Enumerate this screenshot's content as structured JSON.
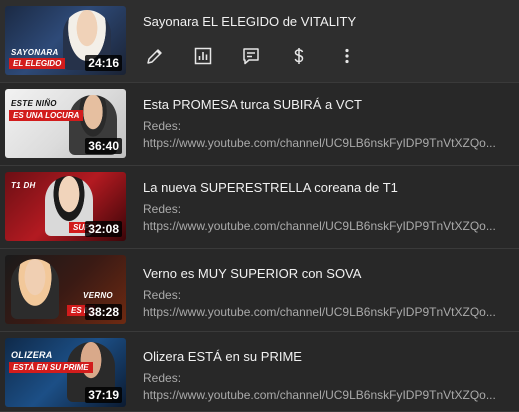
{
  "videos": [
    {
      "title": "Sayonara EL ELEGIDO de VITALITY",
      "duration": "24:16",
      "thumb_line": "SAYONARA",
      "thumb_red": "EL ELEGIDO",
      "actions": [
        "edit-icon",
        "analytics-icon",
        "comments-icon",
        "monetization-icon",
        "more-options-icon"
      ]
    },
    {
      "title": "Esta PROMESA turca SUBIRÁ a VCT",
      "duration": "36:40",
      "thumb_line": "ESTE NIÑO",
      "thumb_red": "ES UNA LOCURA",
      "desc_label": "Redes:",
      "desc_url": "https://www.youtube.com/channel/UC9LB6nskFyIDP9TnVtXZQo..."
    },
    {
      "title": "La nueva SUPERESTRELLA coreana de T1",
      "duration": "32:08",
      "thumb_line": "T1 DH",
      "thumb_red": "SUPI",
      "desc_label": "Redes:",
      "desc_url": "https://www.youtube.com/channel/UC9LB6nskFyIDP9TnVtXZQo..."
    },
    {
      "title": "Verno es MUY SUPERIOR con SOVA",
      "duration": "38:28",
      "thumb_line": "VERNO",
      "thumb_red": "ES M",
      "desc_label": "Redes:",
      "desc_url": "https://www.youtube.com/channel/UC9LB6nskFyIDP9TnVtXZQo..."
    },
    {
      "title": "Olizera ESTÁ en su PRIME",
      "duration": "37:19",
      "thumb_line": "OLIZERA",
      "thumb_red": "ESTÁ EN SU PRIME",
      "desc_label": "Redes:",
      "desc_url": "https://www.youtube.com/channel/UC9LB6nskFyIDP9TnVtXZQo..."
    }
  ],
  "colors": {
    "background": "#282828",
    "title": "#f1f1f1",
    "description": "#aaaaaa",
    "accent_red": "#d21c1c"
  }
}
